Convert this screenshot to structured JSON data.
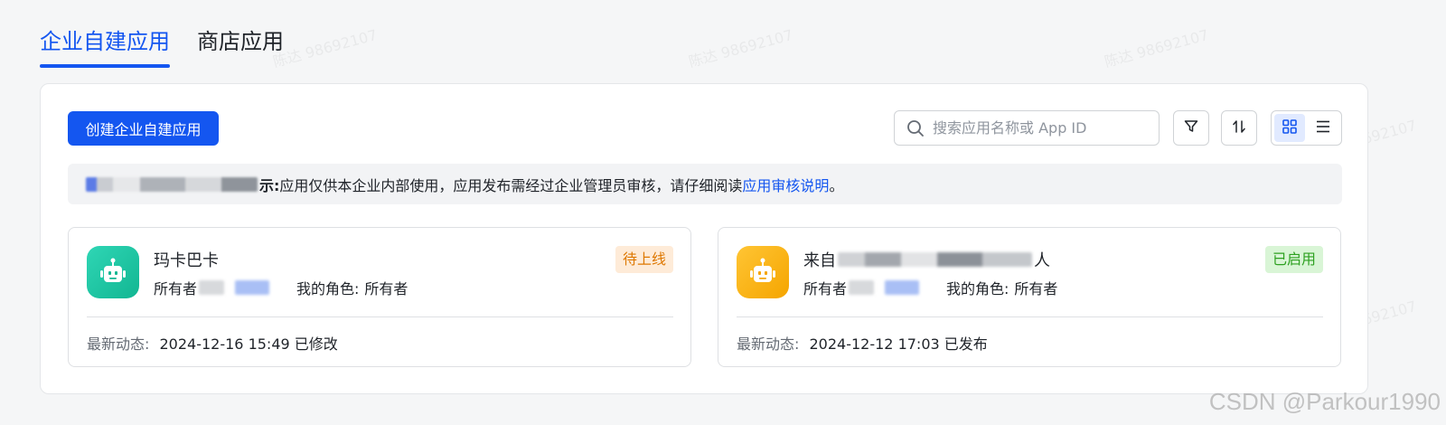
{
  "tabs": [
    {
      "label": "企业自建应用",
      "active": true
    },
    {
      "label": "商店应用",
      "active": false
    }
  ],
  "toolbar": {
    "create_label": "创建企业自建应用",
    "search_placeholder": "搜索应用名称或 App ID",
    "filter_icon": "filter-icon",
    "sort_icon": "sort-icon",
    "grid_view_icon": "grid-view-icon",
    "list_view_icon": "list-view-icon"
  },
  "notice": {
    "tail_bold": "示:",
    "text": " 应用仅供本企业内部使用，应用发布需经过企业管理员审核，请仔细阅读 ",
    "link": "应用审核说明",
    "end": "。"
  },
  "apps": [
    {
      "name": "玛卡巴卡",
      "owner_label": "所有者",
      "role_label": "我的角色:",
      "role": "所有者",
      "status": "待上线",
      "status_color": "#de7802",
      "status_bg": "#feebd8",
      "icon_color": "#1fc7a8",
      "activity_label": "最新动态:",
      "activity": "2024-12-16 15:49 已修改"
    },
    {
      "name": "来自",
      "name_tail": "人",
      "owner_label": "所有者",
      "role_label": "我的角色:",
      "role": "所有者",
      "status": "已启用",
      "status_color": "#2ea121",
      "status_bg": "#d9f5d6",
      "icon_color": "#fab007",
      "activity_label": "最新动态:",
      "activity": "2024-12-12 17:03 已发布"
    }
  ],
  "watermark": "陈达 98692107",
  "footer_credit": "CSDN @Parkour1990",
  "colors": {
    "accent": "#1456f0",
    "background": "#f5f6f7"
  }
}
